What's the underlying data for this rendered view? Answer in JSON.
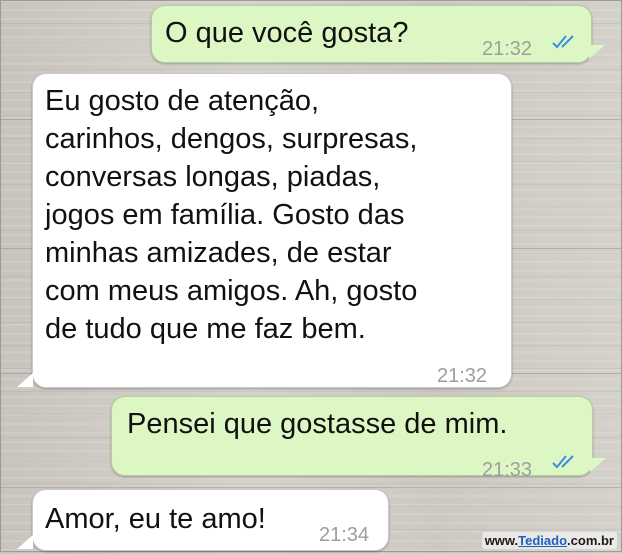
{
  "messages": [
    {
      "direction": "sent",
      "text": "O que você gosta?",
      "time": "21:32",
      "status_icon": "double-check-icon"
    },
    {
      "direction": "received",
      "lines": [
        "Eu gosto de atenção,",
        "carinhos, dengos, surpresas,",
        "conversas longas, piadas,",
        "jogos em família. Gosto das",
        "minhas amizades, de estar",
        "com meus amigos. Ah, gosto",
        "de tudo que me faz bem."
      ],
      "time": "21:32"
    },
    {
      "direction": "sent",
      "text": "Pensei que gostasse de mim.",
      "time": "21:33",
      "status_icon": "double-check-icon"
    },
    {
      "direction": "received",
      "text": "Amor, eu te amo!",
      "time": "21:34"
    }
  ],
  "watermark": {
    "prefix": "www.",
    "brand": "Tediado",
    "suffix": ".com.br"
  },
  "colors": {
    "sent_bubble": "#ddf7c4",
    "received_bubble": "#ffffff",
    "read_ticks": "#3e8ed8",
    "timestamp": "#9aa198"
  }
}
